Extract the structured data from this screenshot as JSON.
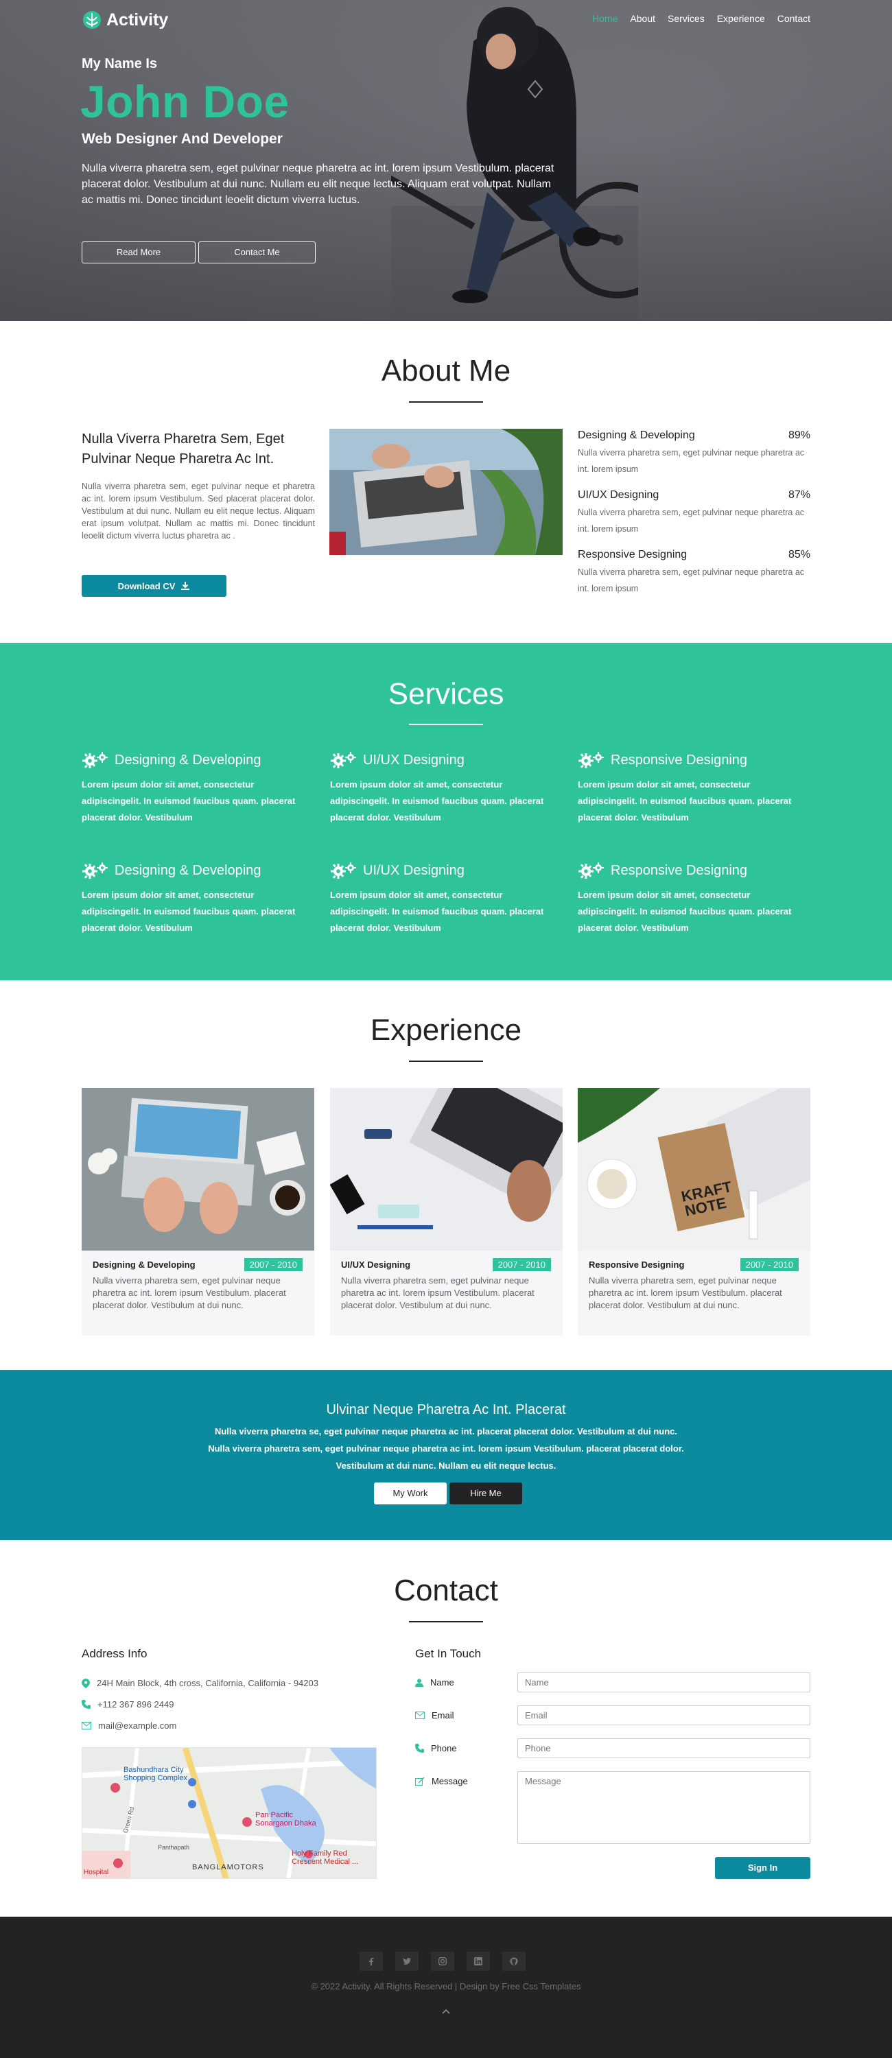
{
  "nav": {
    "brand": "Activity",
    "links": [
      "Home",
      "About",
      "Services",
      "Experience",
      "Contact"
    ],
    "active": "Home"
  },
  "hero": {
    "pre_title": "My Name Is",
    "name": "John Doe",
    "role": "Web Designer And Developer",
    "text": "Nulla viverra pharetra sem, eget pulvinar neque pharetra ac int. lorem ipsum Vestibulum. placerat placerat dolor. Vestibulum at dui nunc. Nullam eu elit neque lectus. Aliquam erat volutpat. Nullam ac mattis mi. Donec tincidunt leoelit dictum viverra luctus.",
    "buttons": [
      "Read More",
      "Contact Me"
    ]
  },
  "about": {
    "title": "About Me",
    "heading": "Nulla Viverra Pharetra Sem, Eget Pulvinar Neque Pharetra Ac Int.",
    "text": "Nulla viverra pharetra sem, eget pulvinar neque et pharetra ac int. lorem ipsum Vestibulum. Sed placerat placerat dolor. Vestibulum at dui nunc. Nullam eu elit neque lectus. Aliquam erat ipsum volutpat. Nullam ac mattis mi. Donec tincidunt leoelit dictum viverra luctus pharetra ac .",
    "cv_button": "Download CV",
    "skills": [
      {
        "name": "Designing & Developing",
        "percent": "89%",
        "desc": "Nulla viverra pharetra sem, eget pulvinar neque pharetra ac int. lorem ipsum"
      },
      {
        "name": "UI/UX Designing",
        "percent": "87%",
        "desc": "Nulla viverra pharetra sem, eget pulvinar neque pharetra ac int. lorem ipsum"
      },
      {
        "name": "Responsive Designing",
        "percent": "85%",
        "desc": "Nulla viverra pharetra sem, eget pulvinar neque pharetra ac int. lorem ipsum"
      }
    ]
  },
  "services": {
    "title": "Services",
    "items": [
      {
        "name": "Designing & Developing",
        "desc": "Lorem ipsum dolor sit amet, consectetur adipiscingelit. In euismod faucibus quam. placerat placerat dolor. Vestibulum"
      },
      {
        "name": "UI/UX Designing",
        "desc": "Lorem ipsum dolor sit amet, consectetur adipiscingelit. In euismod faucibus quam. placerat placerat dolor. Vestibulum"
      },
      {
        "name": "Responsive Designing",
        "desc": "Lorem ipsum dolor sit amet, consectetur adipiscingelit. In euismod faucibus quam. placerat placerat dolor. Vestibulum"
      },
      {
        "name": "Designing & Developing",
        "desc": "Lorem ipsum dolor sit amet, consectetur adipiscingelit. In euismod faucibus quam. placerat placerat dolor. Vestibulum"
      },
      {
        "name": "UI/UX Designing",
        "desc": "Lorem ipsum dolor sit amet, consectetur adipiscingelit. In euismod faucibus quam. placerat placerat dolor. Vestibulum"
      },
      {
        "name": "Responsive Designing",
        "desc": "Lorem ipsum dolor sit amet, consectetur adipiscingelit. In euismod faucibus quam. placerat placerat dolor. Vestibulum"
      }
    ]
  },
  "experience": {
    "title": "Experience",
    "items": [
      {
        "name": "Designing & Developing",
        "years": "2007 - 2010",
        "desc": "Nulla viverra pharetra sem, eget pulvinar neque pharetra ac int. lorem ipsum Vestibulum. placerat placerat dolor. Vestibulum at dui nunc."
      },
      {
        "name": "UI/UX Designing",
        "years": "2007 - 2010",
        "desc": "Nulla viverra pharetra sem, eget pulvinar neque pharetra ac int. lorem ipsum Vestibulum. placerat placerat dolor. Vestibulum at dui nunc."
      },
      {
        "name": "Responsive Designing",
        "years": "2007 - 2010",
        "desc": "Nulla viverra pharetra sem, eget pulvinar neque pharetra ac int. lorem ipsum Vestibulum. placerat placerat dolor. Vestibulum at dui nunc."
      }
    ]
  },
  "cta": {
    "title": "Ulvinar Neque Pharetra Ac Int. Placerat",
    "text": "Nulla viverra pharetra se, eget pulvinar neque pharetra ac int. placerat placerat dolor. Vestibulum at dui nunc. Nulla viverra pharetra sem, eget pulvinar neque pharetra ac int. lorem ipsum Vestibulum. placerat placerat dolor. Vestibulum at dui nunc. Nullam eu elit neque lectus.",
    "buttons": [
      "My Work",
      "Hire Me"
    ]
  },
  "contact": {
    "title": "Contact",
    "address_heading": "Address Info",
    "address": "24H Main Block, 4th cross, California, California - 94203",
    "phone": "+112 367 896 2449",
    "email": "mail@example.com",
    "map_labels": [
      "Bashundhara City Shopping Complex",
      "Pan Pacific Sonargaon Dhaka",
      "Holy Family Red Crescent Medical ...",
      "BANGLAMOTORS",
      "Green Rd",
      "Panthapath",
      "Hospital"
    ],
    "form_heading": "Get In Touch",
    "fields": [
      {
        "label": "Name",
        "placeholder": "Name"
      },
      {
        "label": "Email",
        "placeholder": "Email"
      },
      {
        "label": "Phone",
        "placeholder": "Phone"
      },
      {
        "label": "Message",
        "placeholder": "Message"
      }
    ],
    "submit": "Sign In"
  },
  "footer": {
    "social": [
      "facebook-icon",
      "twitter-icon",
      "instagram-icon",
      "linkedin-icon",
      "github-icon"
    ],
    "copyright": "© 2022 Activity. All Rights Reserved | Design by Free Css Templates"
  },
  "colors": {
    "accent": "#2ec39a",
    "teal": "#0c8a9e",
    "footer": "#232325"
  }
}
